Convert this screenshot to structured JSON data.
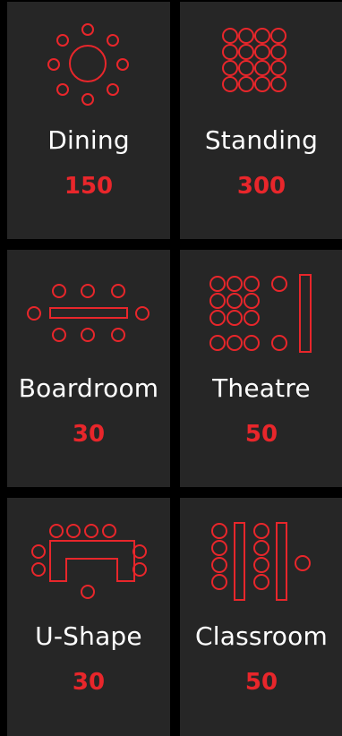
{
  "accent_color": "#e8262b",
  "layouts": [
    {
      "name": "Dining",
      "capacity": "150",
      "icon": "dining-layout-icon"
    },
    {
      "name": "Standing",
      "capacity": "300",
      "icon": "standing-layout-icon"
    },
    {
      "name": "Boardroom",
      "capacity": "30",
      "icon": "boardroom-layout-icon"
    },
    {
      "name": "Theatre",
      "capacity": "50",
      "icon": "theatre-layout-icon"
    },
    {
      "name": "U-Shape",
      "capacity": "30",
      "icon": "u-shape-layout-icon"
    },
    {
      "name": "Classroom",
      "capacity": "50",
      "icon": "classroom-layout-icon"
    }
  ]
}
